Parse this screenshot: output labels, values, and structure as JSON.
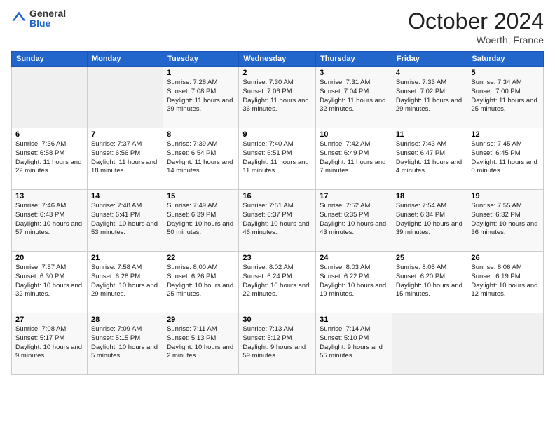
{
  "header": {
    "logo_general": "General",
    "logo_blue": "Blue",
    "month": "October 2024",
    "location": "Woerth, France"
  },
  "weekdays": [
    "Sunday",
    "Monday",
    "Tuesday",
    "Wednesday",
    "Thursday",
    "Friday",
    "Saturday"
  ],
  "weeks": [
    [
      null,
      null,
      {
        "day": 1,
        "sunrise": "7:28 AM",
        "sunset": "7:08 PM",
        "daylight": "11 hours and 39 minutes."
      },
      {
        "day": 2,
        "sunrise": "7:30 AM",
        "sunset": "7:06 PM",
        "daylight": "11 hours and 36 minutes."
      },
      {
        "day": 3,
        "sunrise": "7:31 AM",
        "sunset": "7:04 PM",
        "daylight": "11 hours and 32 minutes."
      },
      {
        "day": 4,
        "sunrise": "7:33 AM",
        "sunset": "7:02 PM",
        "daylight": "11 hours and 29 minutes."
      },
      {
        "day": 5,
        "sunrise": "7:34 AM",
        "sunset": "7:00 PM",
        "daylight": "11 hours and 25 minutes."
      }
    ],
    [
      {
        "day": 6,
        "sunrise": "7:36 AM",
        "sunset": "6:58 PM",
        "daylight": "11 hours and 22 minutes."
      },
      {
        "day": 7,
        "sunrise": "7:37 AM",
        "sunset": "6:56 PM",
        "daylight": "11 hours and 18 minutes."
      },
      {
        "day": 8,
        "sunrise": "7:39 AM",
        "sunset": "6:54 PM",
        "daylight": "11 hours and 14 minutes."
      },
      {
        "day": 9,
        "sunrise": "7:40 AM",
        "sunset": "6:51 PM",
        "daylight": "11 hours and 11 minutes."
      },
      {
        "day": 10,
        "sunrise": "7:42 AM",
        "sunset": "6:49 PM",
        "daylight": "11 hours and 7 minutes."
      },
      {
        "day": 11,
        "sunrise": "7:43 AM",
        "sunset": "6:47 PM",
        "daylight": "11 hours and 4 minutes."
      },
      {
        "day": 12,
        "sunrise": "7:45 AM",
        "sunset": "6:45 PM",
        "daylight": "11 hours and 0 minutes."
      }
    ],
    [
      {
        "day": 13,
        "sunrise": "7:46 AM",
        "sunset": "6:43 PM",
        "daylight": "10 hours and 57 minutes."
      },
      {
        "day": 14,
        "sunrise": "7:48 AM",
        "sunset": "6:41 PM",
        "daylight": "10 hours and 53 minutes."
      },
      {
        "day": 15,
        "sunrise": "7:49 AM",
        "sunset": "6:39 PM",
        "daylight": "10 hours and 50 minutes."
      },
      {
        "day": 16,
        "sunrise": "7:51 AM",
        "sunset": "6:37 PM",
        "daylight": "10 hours and 46 minutes."
      },
      {
        "day": 17,
        "sunrise": "7:52 AM",
        "sunset": "6:35 PM",
        "daylight": "10 hours and 43 minutes."
      },
      {
        "day": 18,
        "sunrise": "7:54 AM",
        "sunset": "6:34 PM",
        "daylight": "10 hours and 39 minutes."
      },
      {
        "day": 19,
        "sunrise": "7:55 AM",
        "sunset": "6:32 PM",
        "daylight": "10 hours and 36 minutes."
      }
    ],
    [
      {
        "day": 20,
        "sunrise": "7:57 AM",
        "sunset": "6:30 PM",
        "daylight": "10 hours and 32 minutes."
      },
      {
        "day": 21,
        "sunrise": "7:58 AM",
        "sunset": "6:28 PM",
        "daylight": "10 hours and 29 minutes."
      },
      {
        "day": 22,
        "sunrise": "8:00 AM",
        "sunset": "6:26 PM",
        "daylight": "10 hours and 25 minutes."
      },
      {
        "day": 23,
        "sunrise": "8:02 AM",
        "sunset": "6:24 PM",
        "daylight": "10 hours and 22 minutes."
      },
      {
        "day": 24,
        "sunrise": "8:03 AM",
        "sunset": "6:22 PM",
        "daylight": "10 hours and 19 minutes."
      },
      {
        "day": 25,
        "sunrise": "8:05 AM",
        "sunset": "6:20 PM",
        "daylight": "10 hours and 15 minutes."
      },
      {
        "day": 26,
        "sunrise": "8:06 AM",
        "sunset": "6:19 PM",
        "daylight": "10 hours and 12 minutes."
      }
    ],
    [
      {
        "day": 27,
        "sunrise": "7:08 AM",
        "sunset": "5:17 PM",
        "daylight": "10 hours and 9 minutes."
      },
      {
        "day": 28,
        "sunrise": "7:09 AM",
        "sunset": "5:15 PM",
        "daylight": "10 hours and 5 minutes."
      },
      {
        "day": 29,
        "sunrise": "7:11 AM",
        "sunset": "5:13 PM",
        "daylight": "10 hours and 2 minutes."
      },
      {
        "day": 30,
        "sunrise": "7:13 AM",
        "sunset": "5:12 PM",
        "daylight": "9 hours and 59 minutes."
      },
      {
        "day": 31,
        "sunrise": "7:14 AM",
        "sunset": "5:10 PM",
        "daylight": "9 hours and 55 minutes."
      },
      null,
      null
    ]
  ]
}
